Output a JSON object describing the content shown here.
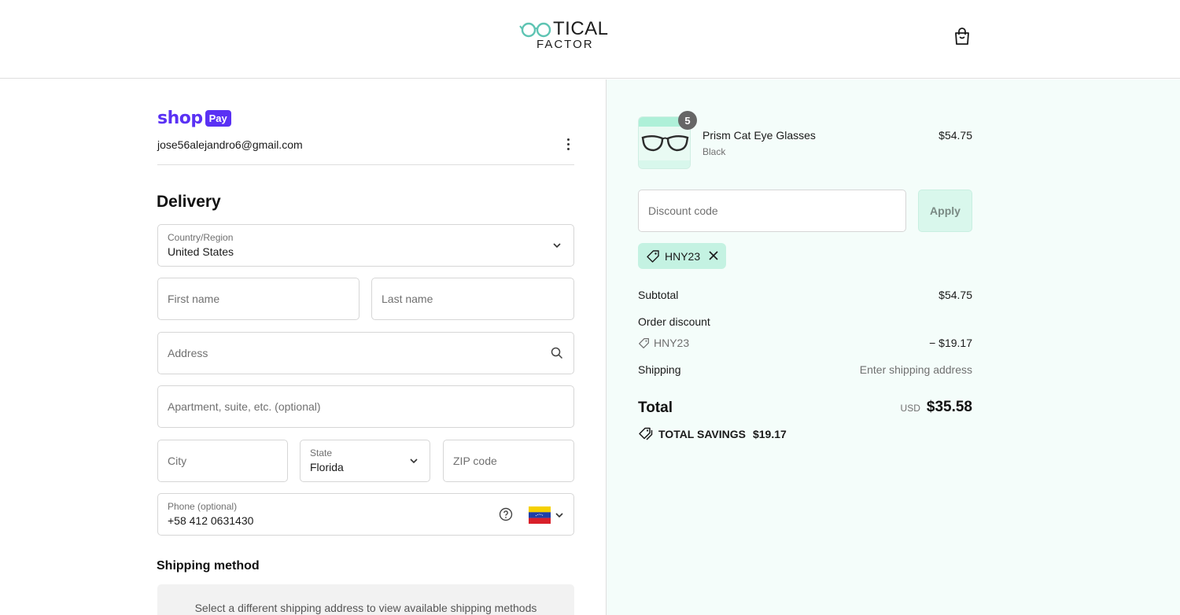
{
  "brand": {
    "logo_line1": "TICAL",
    "logo_line2": "FACTOR",
    "accent": "#5ec4b3"
  },
  "account": {
    "shop_word": "shop",
    "pay_badge": "Pay",
    "email": "jose56alejandro6@gmail.com"
  },
  "delivery": {
    "heading": "Delivery",
    "country": {
      "label": "Country/Region",
      "value": "United States"
    },
    "first_name": {
      "placeholder": "First name"
    },
    "last_name": {
      "placeholder": "Last name"
    },
    "address": {
      "placeholder": "Address"
    },
    "apartment": {
      "placeholder": "Apartment, suite, etc. (optional)"
    },
    "city": {
      "placeholder": "City"
    },
    "state": {
      "label": "State",
      "value": "Florida"
    },
    "zip": {
      "placeholder": "ZIP code"
    },
    "phone": {
      "label": "Phone (optional)",
      "value": "+58 412 0631430",
      "flag": "venezuela-flag"
    }
  },
  "shipping_method": {
    "heading": "Shipping method",
    "note": "Select a different shipping address to view available shipping methods"
  },
  "order": {
    "item": {
      "name": "Prism Cat Eye Glasses",
      "variant": "Black",
      "price": "$54.75",
      "quantity": "5"
    },
    "discount": {
      "placeholder": "Discount code",
      "apply_label": "Apply",
      "applied_code": "HNY23"
    },
    "summary": {
      "subtotal_label": "Subtotal",
      "subtotal_value": "$54.75",
      "order_discount_label": "Order discount",
      "discount_code": "HNY23",
      "discount_value": "− $19.17",
      "shipping_label": "Shipping",
      "shipping_value": "Enter shipping address",
      "total_label": "Total",
      "currency": "USD",
      "total_value": "$35.58",
      "savings_label": "TOTAL SAVINGS",
      "savings_value": "$19.17"
    }
  },
  "colors": {
    "shop_pay": "#5a31f4",
    "summary_bg": "#f4fdfa",
    "chip_bg": "#c4f2e2"
  }
}
